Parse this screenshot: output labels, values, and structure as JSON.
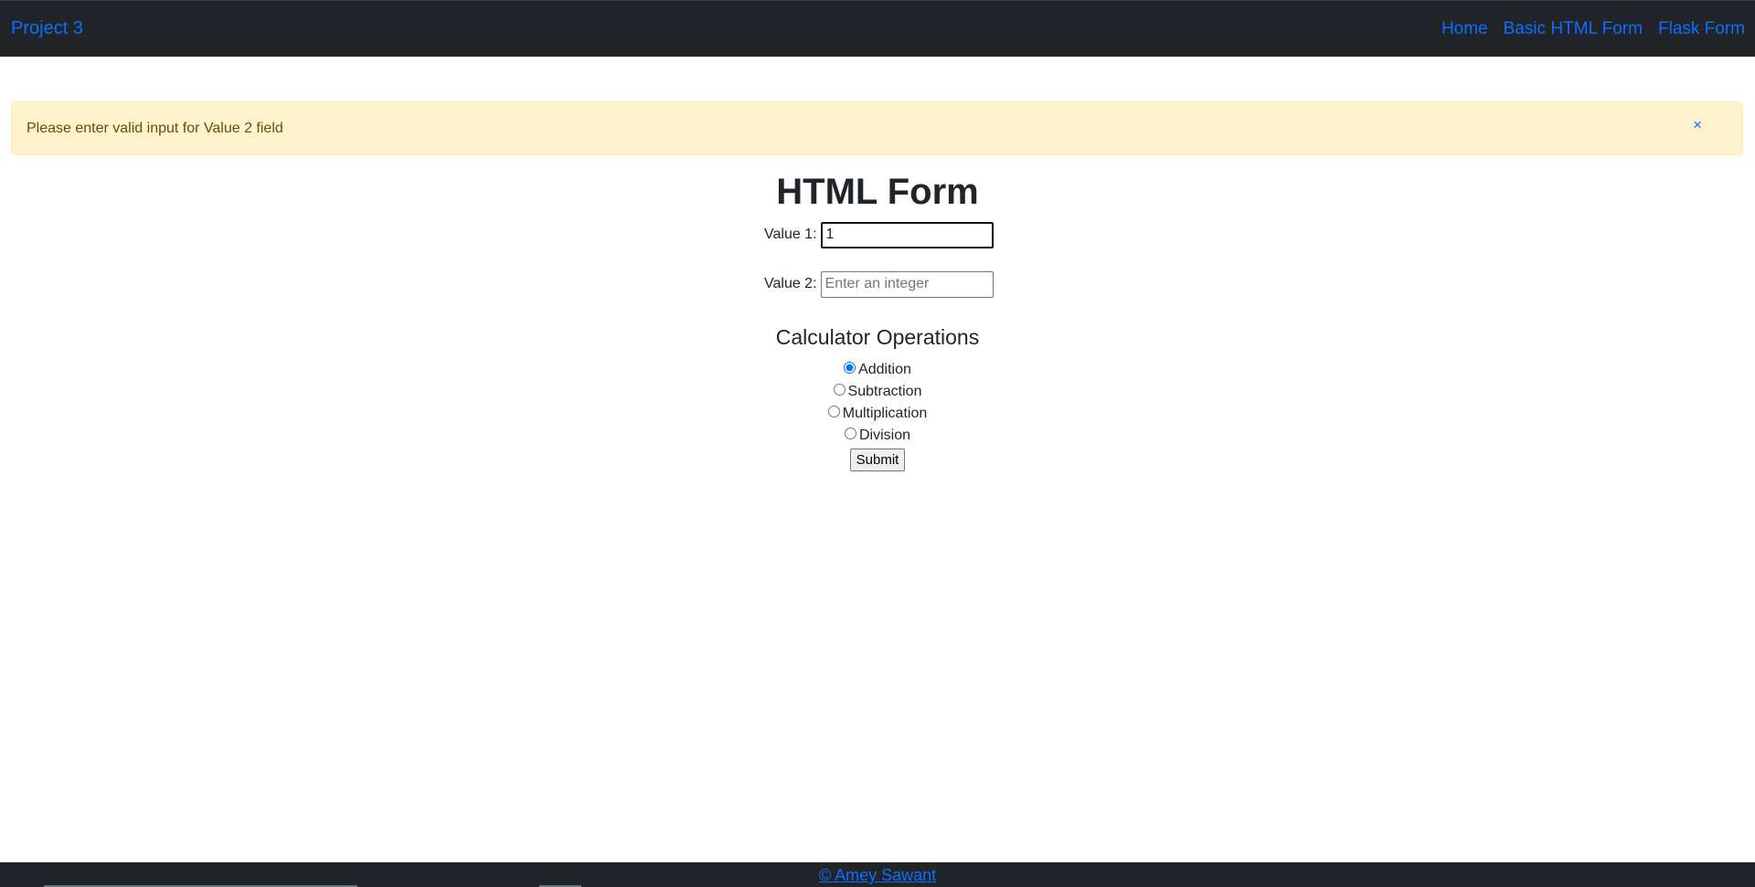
{
  "navbar": {
    "brand": "Project 3",
    "links": [
      "Home",
      "Basic HTML Form",
      "Flask Form"
    ],
    "background": "#212529",
    "link_color": "#0d6efd"
  },
  "alert": {
    "message": "Please enter valid input for Value 2 field",
    "close_symbol": "×",
    "background": "#fff3cd"
  },
  "form": {
    "title": "HTML Form",
    "value1": {
      "label": "Value 1:",
      "value": "1",
      "placeholder": "Enter an integer"
    },
    "value2": {
      "label": "Value 2:",
      "value": "",
      "placeholder": "Enter an integer"
    },
    "operations_title": "Calculator Operations",
    "operations": [
      {
        "label": "Addition",
        "checked": true
      },
      {
        "label": "Subtraction",
        "checked": false
      },
      {
        "label": "Multiplication",
        "checked": false
      },
      {
        "label": "Division",
        "checked": false
      }
    ],
    "submit_label": "Submit"
  },
  "footer": {
    "text": "© Amey Sawant",
    "background": "#212529"
  }
}
